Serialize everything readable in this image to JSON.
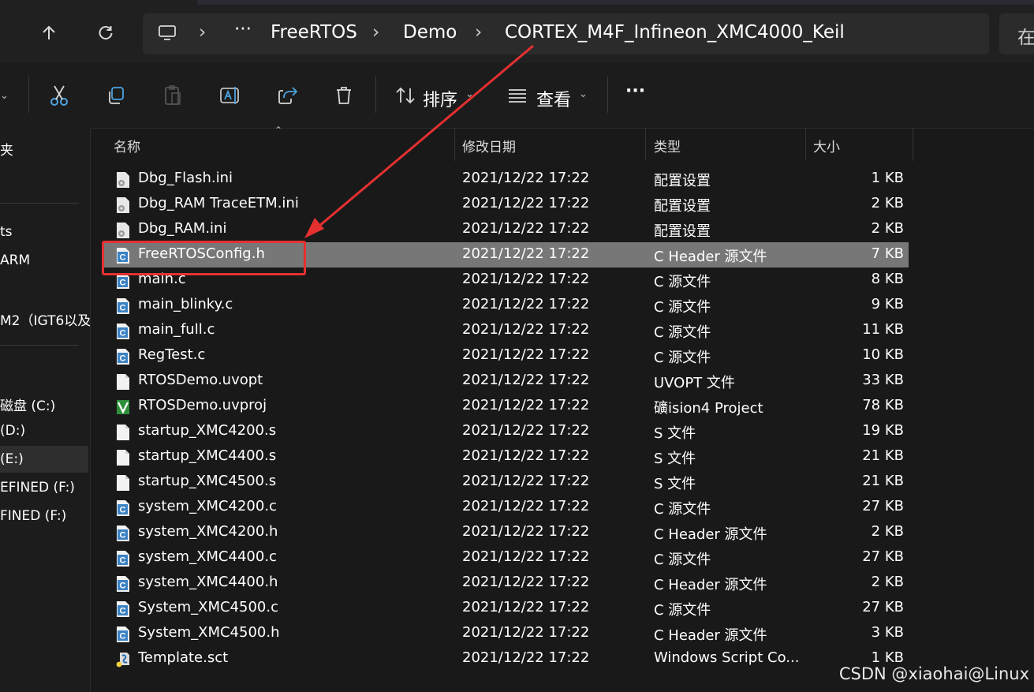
{
  "address": {
    "ellipsis": "···",
    "segments": [
      "FreeRTOS",
      "Demo",
      "CORTEX_M4F_Infineon_XMC4000_Keil"
    ],
    "search_text": "在"
  },
  "toolbar": {
    "sort_label": "排序",
    "view_label": "查看",
    "more_label": "···"
  },
  "sidebar": {
    "items": [
      "夹",
      "ts",
      "ARM",
      "M2（IGT6以及",
      "磁盘 (C:)",
      "(D:)",
      "(E:)",
      "EFINED (F:)",
      "FINED (F:)"
    ]
  },
  "columns": {
    "name": "名称",
    "date": "修改日期",
    "type": "类型",
    "size": "大小"
  },
  "files": [
    {
      "name": "Dbg_Flash.ini",
      "date": "2021/12/22 17:22",
      "type": "配置设置",
      "size": "1 KB",
      "icon": "settings-file-icon"
    },
    {
      "name": "Dbg_RAM TraceETM.ini",
      "date": "2021/12/22 17:22",
      "type": "配置设置",
      "size": "2 KB",
      "icon": "settings-file-icon"
    },
    {
      "name": "Dbg_RAM.ini",
      "date": "2021/12/22 17:22",
      "type": "配置设置",
      "size": "2 KB",
      "icon": "settings-file-icon"
    },
    {
      "name": "FreeRTOSConfig.h",
      "date": "2021/12/22 17:22",
      "type": "C Header 源文件",
      "size": "7 KB",
      "icon": "c-file-icon",
      "selected": true
    },
    {
      "name": "main.c",
      "date": "2021/12/22 17:22",
      "type": "C 源文件",
      "size": "8 KB",
      "icon": "c-file-icon"
    },
    {
      "name": "main_blinky.c",
      "date": "2021/12/22 17:22",
      "type": "C 源文件",
      "size": "9 KB",
      "icon": "c-file-icon"
    },
    {
      "name": "main_full.c",
      "date": "2021/12/22 17:22",
      "type": "C 源文件",
      "size": "11 KB",
      "icon": "c-file-icon"
    },
    {
      "name": "RegTest.c",
      "date": "2021/12/22 17:22",
      "type": "C 源文件",
      "size": "10 KB",
      "icon": "c-file-icon"
    },
    {
      "name": "RTOSDemo.uvopt",
      "date": "2021/12/22 17:22",
      "type": "UVOPT 文件",
      "size": "33 KB",
      "icon": "blank-file-icon"
    },
    {
      "name": "RTOSDemo.uvproj",
      "date": "2021/12/22 17:22",
      "type": "礦ision4 Project",
      "size": "78 KB",
      "icon": "keil-project-icon"
    },
    {
      "name": "startup_XMC4200.s",
      "date": "2021/12/22 17:22",
      "type": "S 文件",
      "size": "19 KB",
      "icon": "blank-file-icon"
    },
    {
      "name": "startup_XMC4400.s",
      "date": "2021/12/22 17:22",
      "type": "S 文件",
      "size": "21 KB",
      "icon": "blank-file-icon"
    },
    {
      "name": "startup_XMC4500.s",
      "date": "2021/12/22 17:22",
      "type": "S 文件",
      "size": "21 KB",
      "icon": "blank-file-icon"
    },
    {
      "name": "system_XMC4200.c",
      "date": "2021/12/22 17:22",
      "type": "C 源文件",
      "size": "27 KB",
      "icon": "c-file-icon"
    },
    {
      "name": "system_XMC4200.h",
      "date": "2021/12/22 17:22",
      "type": "C Header 源文件",
      "size": "2 KB",
      "icon": "c-file-icon"
    },
    {
      "name": "system_XMC4400.c",
      "date": "2021/12/22 17:22",
      "type": "C 源文件",
      "size": "27 KB",
      "icon": "c-file-icon"
    },
    {
      "name": "system_XMC4400.h",
      "date": "2021/12/22 17:22",
      "type": "C Header 源文件",
      "size": "2 KB",
      "icon": "c-file-icon"
    },
    {
      "name": "System_XMC4500.c",
      "date": "2021/12/22 17:22",
      "type": "C 源文件",
      "size": "27 KB",
      "icon": "c-file-icon"
    },
    {
      "name": "System_XMC4500.h",
      "date": "2021/12/22 17:22",
      "type": "C Header 源文件",
      "size": "3 KB",
      "icon": "c-file-icon"
    },
    {
      "name": "Template.sct",
      "date": "2021/12/22 17:22",
      "type": "Windows Script Co...",
      "size": "1 KB",
      "icon": "script-file-icon"
    }
  ],
  "watermark": "CSDN @xiaohai@Linux",
  "colors": {
    "background": "#191919",
    "selected_row": "#777777",
    "annotation_red": "#e53030"
  }
}
